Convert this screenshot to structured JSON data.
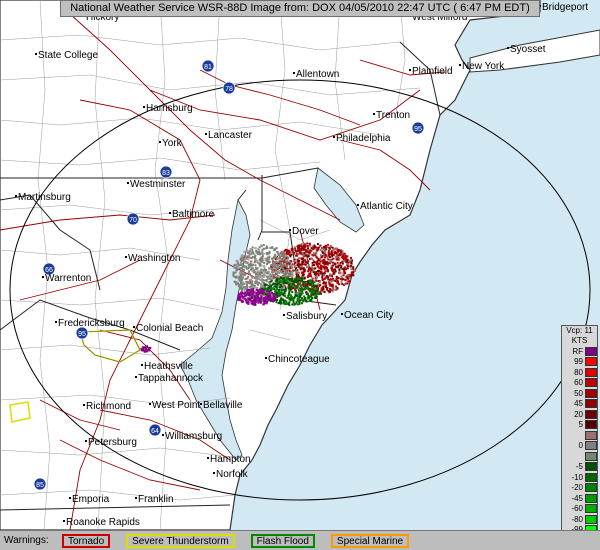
{
  "header": {
    "title": "National Weather Service WSR-88D Image from: DOX 04/05/2010 22:47 UTC ( 6:47 PM EDT)"
  },
  "cities": [
    "State College",
    "Harrisburg",
    "Lancaster",
    "York",
    "Westminster",
    "Martinsburg",
    "Baltimore",
    "Washington",
    "Warrenton",
    "Fredericksburg",
    "Colonial Beach",
    "Heathsville",
    "Tappahannock",
    "Richmond",
    "West Point",
    "Bellaville",
    "Williamsburg",
    "Petersburg",
    "Hampton",
    "Norfolk",
    "Emporia",
    "Franklin",
    "Roanoke Rapids",
    "Allentown",
    "Trenton",
    "Philadelphia",
    "Atlantic City",
    "Dover",
    "Salisbury",
    "Ocean City",
    "Chincoteague",
    "West Milford",
    "Plainfield",
    "New York",
    "Syosset",
    "Bridgeport",
    "Hickory"
  ],
  "highway_shields": [
    "81",
    "78",
    "95",
    "83",
    "70",
    "66",
    "95",
    "64",
    "85"
  ],
  "legend": {
    "title": "Vcp: 11",
    "units": "KTS",
    "entries": [
      {
        "label": "RF",
        "color": "#800080"
      },
      {
        "label": "99",
        "color": "#ff0000"
      },
      {
        "label": "80",
        "color": "#e00000"
      },
      {
        "label": "60",
        "color": "#c00000"
      },
      {
        "label": "50",
        "color": "#a00000"
      },
      {
        "label": "45",
        "color": "#8b0000"
      },
      {
        "label": "20",
        "color": "#700000"
      },
      {
        "label": "5",
        "color": "#500000"
      },
      {
        "label": "",
        "color": "#9a7070"
      },
      {
        "label": "0",
        "color": "#808080"
      },
      {
        "label": "",
        "color": "#708870"
      },
      {
        "label": "-5",
        "color": "#005000"
      },
      {
        "label": "-10",
        "color": "#006600"
      },
      {
        "label": "-20",
        "color": "#008000"
      },
      {
        "label": "-45",
        "color": "#009900"
      },
      {
        "label": "-60",
        "color": "#00b000"
      },
      {
        "label": "-80",
        "color": "#00cc00"
      },
      {
        "label": "-99",
        "color": "#00ff00"
      },
      {
        "label": "ND",
        "color": "#000000"
      }
    ]
  },
  "warnings": {
    "label": "Warnings:",
    "items": [
      {
        "label": "Tornado",
        "color": "#cc0000"
      },
      {
        "label": "Severe Thunderstorm",
        "color": "#dddd00"
      },
      {
        "label": "Flash Flood",
        "color": "#008800"
      },
      {
        "label": "Special Marine",
        "color": "#ff9900"
      }
    ]
  },
  "colors": {
    "land": "#ffffff",
    "water": "#d2e8f2",
    "county_lines": "#9a9a9a",
    "state_lines": "#333333",
    "roads": "#990000",
    "range_ring": "#000000"
  }
}
